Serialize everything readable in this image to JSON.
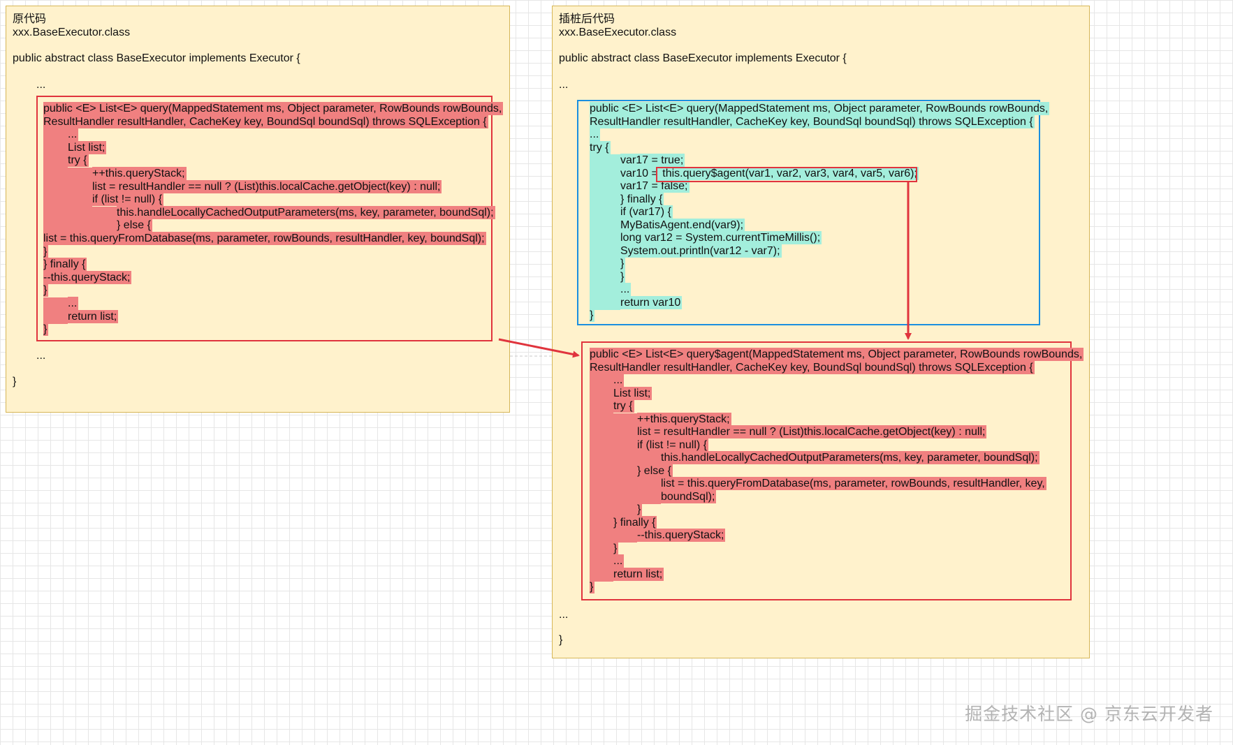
{
  "left": {
    "title": "原代码",
    "class_name": "xxx.BaseExecutor.class",
    "class_decl": "public abstract class BaseExecutor implements Executor {",
    "ellipsis_top": "...",
    "ellipsis_bottom": "...",
    "close_brace": "}",
    "code": [
      {
        "indent": 0,
        "text": "public <E> List<E> query(MappedStatement ms, Object parameter, RowBounds rowBounds,"
      },
      {
        "indent": 0,
        "text": "ResultHandler resultHandler, CacheKey key, BoundSql boundSql) throws SQLException {"
      },
      {
        "indent": 1,
        "text": "..."
      },
      {
        "indent": 1,
        "text": "List list;"
      },
      {
        "indent": 1,
        "text": "try {"
      },
      {
        "indent": 2,
        "text": "++this.queryStack;"
      },
      {
        "indent": 2,
        "text": "list = resultHandler == null ? (List)this.localCache.getObject(key) : null;"
      },
      {
        "indent": 2,
        "text": "if (list != null) {"
      },
      {
        "indent": 3,
        "text": "this.handleLocallyCachedOutputParameters(ms, key, parameter, boundSql);"
      },
      {
        "indent": 3,
        "text": "} else {"
      },
      {
        "indent": 0,
        "text": "list = this.queryFromDatabase(ms, parameter, rowBounds, resultHandler, key, boundSql);"
      },
      {
        "indent": 0,
        "text": "}"
      },
      {
        "indent": 0,
        "text": "} finally {"
      },
      {
        "indent": 0,
        "text": "--this.queryStack;"
      },
      {
        "indent": 0,
        "text": "}"
      },
      {
        "indent": 1,
        "text": "..."
      },
      {
        "indent": 1,
        "text": "return list;"
      },
      {
        "indent": 0,
        "text": "}"
      }
    ]
  },
  "right": {
    "title": "插桩后代码",
    "class_name": "xxx.BaseExecutor.class",
    "class_decl": "public abstract class BaseExecutor implements Executor {",
    "ellipsis_top": "...",
    "ellipsis_bottom": "...",
    "close_brace": "}",
    "wrapper_code": [
      {
        "indent": 0,
        "text": "public <E> List<E> query(MappedStatement ms, Object parameter, RowBounds rowBounds,"
      },
      {
        "indent": 0,
        "text": "ResultHandler resultHandler, CacheKey key, BoundSql boundSql) throws SQLException {"
      },
      {
        "indent": 0,
        "text": "..."
      },
      {
        "indent": 0,
        "text": "try {"
      },
      {
        "indent": 1,
        "text": "var17 = true;"
      },
      {
        "indent": 1,
        "pre": "var10 = ",
        "text": "this.query$agent(var1, var2, var3, var4, var5, var6);"
      },
      {
        "indent": 1,
        "text": "var17 = false;"
      },
      {
        "indent": 1,
        "text": "} finally {"
      },
      {
        "indent": 1,
        "text": "if (var17) {"
      },
      {
        "indent": 1,
        "text": "MyBatisAgent.end(var9);"
      },
      {
        "indent": 1,
        "text": "long var12 = System.currentTimeMillis();"
      },
      {
        "indent": 1,
        "text": "System.out.println(var12 - var7);"
      },
      {
        "indent": 1,
        "text": "}"
      },
      {
        "indent": 1,
        "text": "}"
      },
      {
        "indent": 1,
        "text": "..."
      },
      {
        "indent": 1,
        "text": "return var10"
      },
      {
        "indent": 0,
        "text": "}"
      }
    ],
    "agent_code": [
      {
        "indent": 0,
        "text": "public <E> List<E> query$agent(MappedStatement ms, Object parameter, RowBounds rowBounds,"
      },
      {
        "indent": 0,
        "text": "ResultHandler resultHandler, CacheKey key, BoundSql boundSql) throws SQLException {"
      },
      {
        "indent": 1,
        "text": "..."
      },
      {
        "indent": 1,
        "text": "List list;"
      },
      {
        "indent": 1,
        "text": "try {"
      },
      {
        "indent": 2,
        "text": "++this.queryStack;"
      },
      {
        "indent": 2,
        "text": "list = resultHandler == null ? (List)this.localCache.getObject(key) : null;"
      },
      {
        "indent": 2,
        "text": "if (list != null) {"
      },
      {
        "indent": 3,
        "text": "this.handleLocallyCachedOutputParameters(ms, key, parameter, boundSql);"
      },
      {
        "indent": 2,
        "text": "} else {"
      },
      {
        "indent": 3,
        "text": "list = this.queryFromDatabase(ms, parameter, rowBounds, resultHandler, key,"
      },
      {
        "indent": 3,
        "text": "boundSql);"
      },
      {
        "indent": 2,
        "text": "}"
      },
      {
        "indent": 1,
        "text": "} finally {"
      },
      {
        "indent": 2,
        "text": "--this.queryStack;"
      },
      {
        "indent": 1,
        "text": "}"
      },
      {
        "indent": 1,
        "text": "..."
      },
      {
        "indent": 1,
        "text": "return list;"
      },
      {
        "indent": 0,
        "text": "}"
      }
    ]
  },
  "watermark": "掘金技术社区 @ 京东云开发者",
  "colors": {
    "panel_fill": "#fff2cc",
    "panel_border": "#d6b656",
    "red_box": "#e0343d",
    "blue_box": "#1a8fe0",
    "red_highlight": "#f08080",
    "teal_highlight": "#a3eedc"
  }
}
